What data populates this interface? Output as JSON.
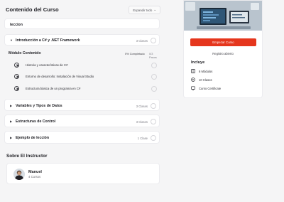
{
  "curriculum": {
    "title": "Contenido del Curso",
    "expand_label": "Expandir todo",
    "sections": [
      {
        "title": "leccion",
        "count": "",
        "expanded": false
      },
      {
        "title": "Introducción a C# y .NET Framework",
        "count": "3 Clases",
        "expanded": true
      },
      {
        "title": "Variables y Tipos de Datos",
        "count": "3 Clases",
        "expanded": false
      },
      {
        "title": "Estructuras de Control",
        "count": "3 Clases",
        "expanded": false
      },
      {
        "title": "Ejemplo de lección",
        "count": "1 Clase",
        "expanded": false
      }
    ],
    "module": {
      "label": "Módulo Contenido",
      "completed": "0% Completado",
      "steps": "0/3 Pasos",
      "lessons": [
        "Historia y características de C#",
        "Entorno de desarrollo: Instalación de Visual Studio",
        "Estructura básica de un programa en C#"
      ]
    }
  },
  "instructor": {
    "heading": "Sobre El Instructor",
    "name": "Manuel",
    "courses": "4 Cursos"
  },
  "sidebar": {
    "cta_label": "Empezar Curso",
    "enrollment": "Registro abierto",
    "includes_heading": "Incluye",
    "includes": [
      {
        "icon": "book-icon",
        "label": "6 Módulos"
      },
      {
        "icon": "play-icon",
        "label": "10 Clases"
      },
      {
        "icon": "certificate-icon",
        "label": "Curso Certificate"
      }
    ]
  },
  "colors": {
    "accent": "#e5361d"
  }
}
